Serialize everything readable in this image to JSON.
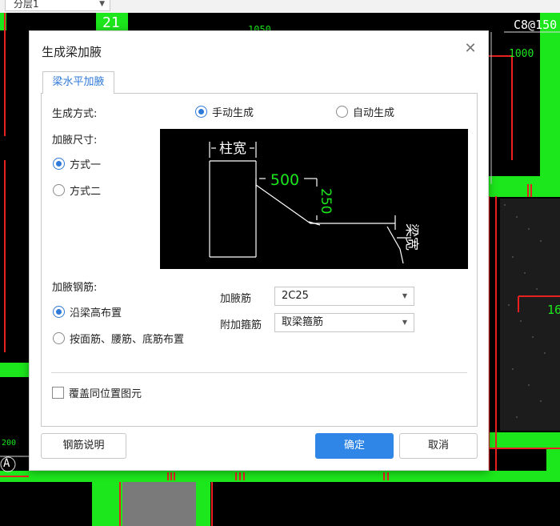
{
  "toolbar": {
    "layer_select": "分层1"
  },
  "cad": {
    "label_21": "21",
    "label_1050": "1050",
    "label_c8150": "C8@150",
    "label_1000": "1000",
    "label_16": "16",
    "label_A": "A",
    "label_200": "200"
  },
  "dialog": {
    "title": "生成梁加腋",
    "close_icon": "close-icon",
    "tab": "梁水平加腋",
    "generate_mode_label": "生成方式:",
    "manual_label": "手动生成",
    "auto_label": "自动生成",
    "generate_mode_selected": "manual",
    "haunch_size_label": "加腋尺寸:",
    "mode1_label": "方式一",
    "mode2_label": "方式二",
    "size_mode_selected": "mode1",
    "preview": {
      "column_width": "柱宽",
      "dim_500": "500",
      "dim_250": "250",
      "beam_width": "梁宽"
    },
    "rebar_label": "加腋钢筋:",
    "rebar_opt1": "沿梁高布置",
    "rebar_opt2": "按面筋、腰筋、底筋布置",
    "rebar_selected": "opt1",
    "haunch_bar_label": "加腋筋",
    "haunch_bar_value": "2C25",
    "stirrup_label": "附加箍筋",
    "stirrup_value": "取梁箍筋",
    "overwrite_label": "覆盖同位置图元",
    "overwrite_checked": false,
    "rebar_info_button": "钢筋说明",
    "ok_button": "确定",
    "cancel_button": "取消"
  },
  "colors": {
    "accent": "#2f79d8",
    "primary_button": "#2f86e6",
    "cad_green": "#1ce61c",
    "cad_red": "#e82020"
  }
}
